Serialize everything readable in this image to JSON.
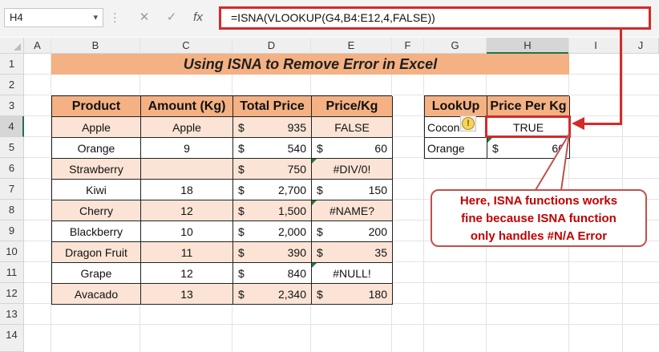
{
  "name_box": {
    "value": "H4"
  },
  "formula_bar": {
    "cancel_icon": "✕",
    "enter_icon": "✓",
    "fx_label": "fx",
    "formula": "=ISNA(VLOOKUP(G4,B4:E12,4,FALSE))"
  },
  "columns": [
    "A",
    "B",
    "C",
    "D",
    "E",
    "F",
    "G",
    "H",
    "I",
    "J"
  ],
  "rows": [
    "1",
    "2",
    "3",
    "4",
    "5",
    "6",
    "7",
    "8",
    "9",
    "10",
    "11",
    "12",
    "13",
    "14"
  ],
  "title": "Using ISNA to Remove Error in Excel",
  "main_table": {
    "headers": [
      "Product",
      "Amount (Kg)",
      "Total Price",
      "Price/Kg"
    ],
    "currency": "$",
    "rows": [
      {
        "product": "Apple",
        "amount": "Apple",
        "total": "935",
        "price_kg": "FALSE",
        "price_is_num": false
      },
      {
        "product": "Orange",
        "amount": "9",
        "total": "540",
        "price_kg": "60",
        "price_is_num": true
      },
      {
        "product": "Strawberry",
        "amount": "",
        "total": "750",
        "price_kg": "#DIV/0!",
        "price_is_num": false
      },
      {
        "product": "Kiwi",
        "amount": "18",
        "total": "2,700",
        "price_kg": "150",
        "price_is_num": true
      },
      {
        "product": "Cherry",
        "amount": "12",
        "total": "1,500",
        "price_kg": "#NAME?",
        "price_is_num": false
      },
      {
        "product": "Blackberry",
        "amount": "10",
        "total": "2,000",
        "price_kg": "200",
        "price_is_num": true
      },
      {
        "product": "Dragon Fruit",
        "amount": "11",
        "total": "390",
        "price_kg": "35",
        "price_is_num": true
      },
      {
        "product": "Grape",
        "amount": "12",
        "total": "840",
        "price_kg": "#NULL!",
        "price_is_num": false
      },
      {
        "product": "Avacado",
        "amount": "13",
        "total": "2,340",
        "price_kg": "180",
        "price_is_num": true
      }
    ]
  },
  "lookup_table": {
    "headers": [
      "LookUp",
      "Price Per Kg"
    ],
    "rows": [
      {
        "lookup": "Coconut",
        "result": "TRUE"
      },
      {
        "lookup": "Orange",
        "result_currency": "$",
        "result": "60"
      }
    ]
  },
  "callout": {
    "line1": "Here, ISNA functions works",
    "line2": "fine because ISNA function",
    "line3": "only handles #N/A Error"
  },
  "colors": {
    "header_fill": "#f4b183",
    "odd_row_fill": "#fbe4d5",
    "highlight": "#d42a2a",
    "callout_text": "#c00000"
  }
}
